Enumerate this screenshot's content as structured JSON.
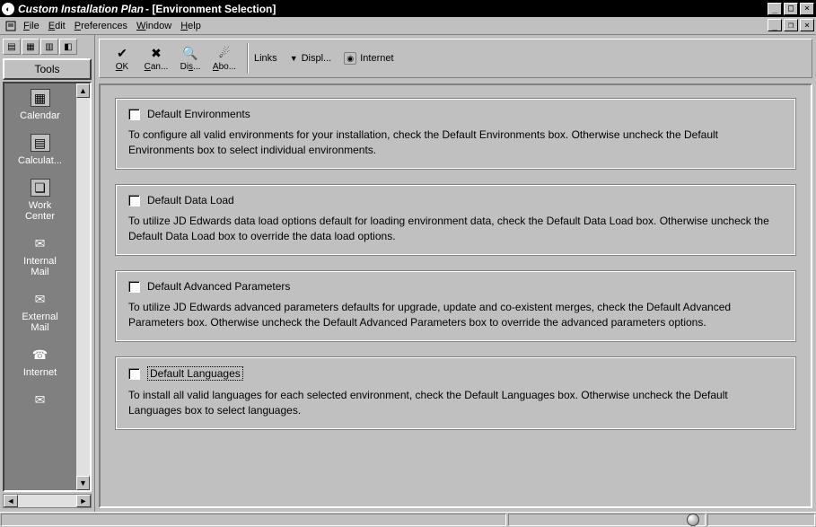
{
  "window": {
    "title_app": "Custom Installation Plan",
    "title_doc": "- [Environment Selection]"
  },
  "menu": {
    "file": "File",
    "edit": "Edit",
    "preferences": "Preferences",
    "window": "Window",
    "help": "Help"
  },
  "tools_panel": {
    "header": "Tools",
    "items": [
      {
        "label": "Calendar",
        "icon": "calendar-icon"
      },
      {
        "label": "Calculat...",
        "icon": "calculator-icon"
      },
      {
        "label": "Work\nCenter",
        "icon": "work-center-icon"
      },
      {
        "label": "Internal\nMail",
        "icon": "mail-icon"
      },
      {
        "label": "External\nMail",
        "icon": "mail-icon"
      },
      {
        "label": "Internet",
        "icon": "phone-icon"
      }
    ]
  },
  "toolbar": {
    "ok": "OK",
    "cancel": "Can...",
    "display": "Dis...",
    "about": "Abo...",
    "links": "Links",
    "displ": "Displ...",
    "internet": "Internet"
  },
  "groups": [
    {
      "title": "Default Environments",
      "desc": "To configure all valid environments for your installation, check the Default Environments box.  Otherwise uncheck the Default Environments box to select individual environments."
    },
    {
      "title": "Default Data Load",
      "desc": "To utilize JD Edwards data load options default for loading environment data, check the Default Data Load box.  Otherwise uncheck the Default Data Load box to override the data load options."
    },
    {
      "title": "Default Advanced Parameters",
      "desc": "To utilize JD Edwards advanced parameters defaults for upgrade, update and co-existent merges, check the Default Advanced Parameters box.  Otherwise uncheck the Default Advanced Parameters box to override the advanced parameters options."
    },
    {
      "title": "Default Languages",
      "desc": "To install all valid languages for each selected environment, check the Default Languages box.  Otherwise uncheck the Default Languages box to select languages."
    }
  ]
}
